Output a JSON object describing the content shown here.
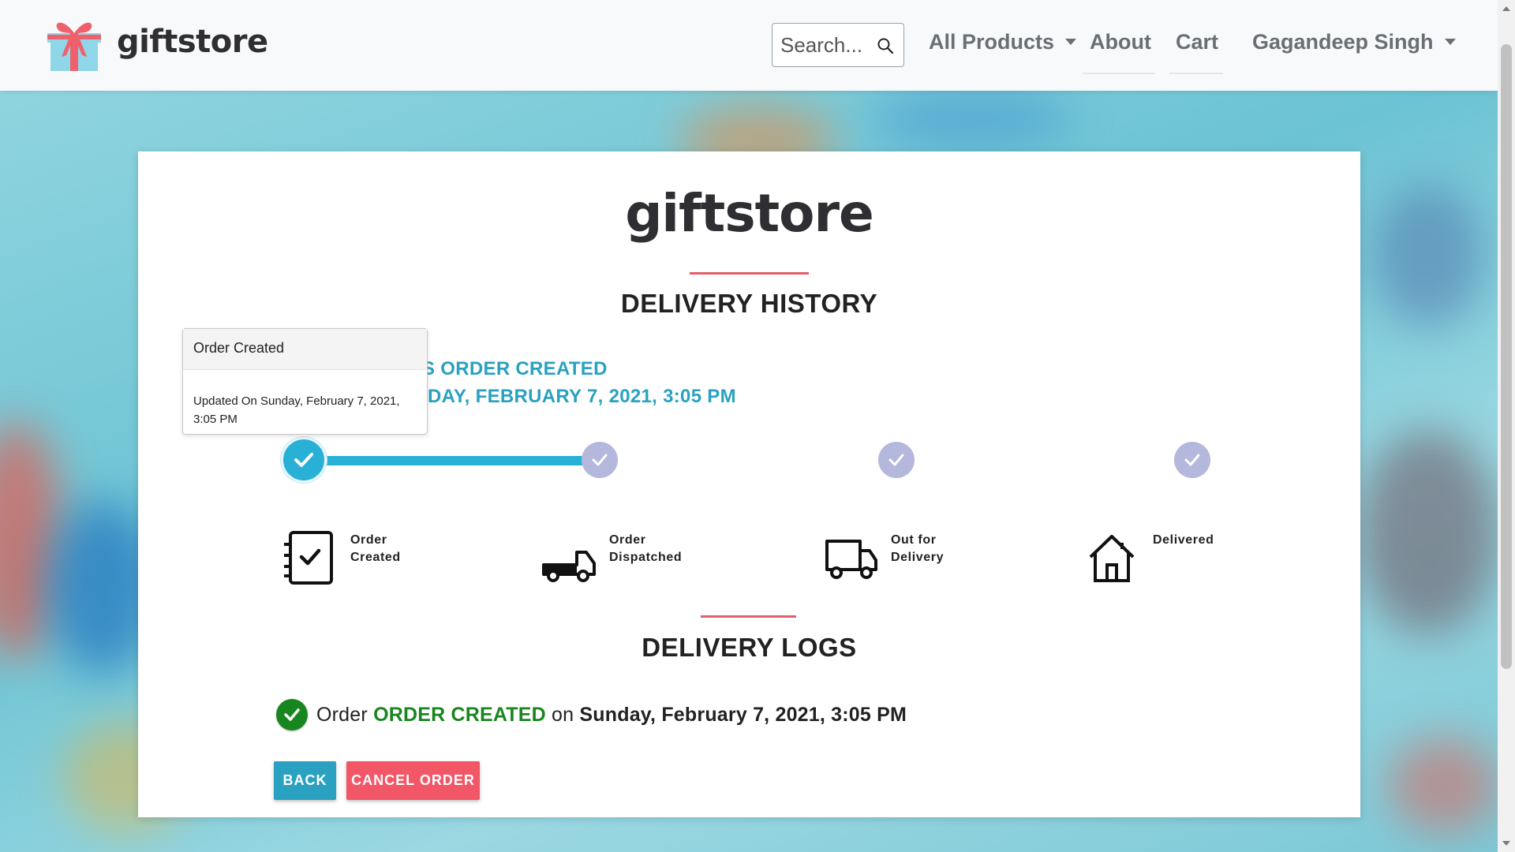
{
  "navbar": {
    "brand": "giftstore",
    "search_placeholder": "Search...",
    "all_products": "All Products",
    "about": "About",
    "cart": "Cart",
    "user": "Gagandeep Singh"
  },
  "card": {
    "brand": "giftstore",
    "history_title": "DELIVERY HISTORY",
    "status_line_1": "S ORDER CREATED",
    "status_line_2": "IDAY, FEBRUARY 7, 2021, 3:05 PM",
    "steps": [
      {
        "label_1": "Order",
        "label_2": "Created",
        "icon": "checklist-icon",
        "done": true
      },
      {
        "label_1": "Order",
        "label_2": "Dispatched",
        "icon": "flatbed-truck-icon",
        "done": false
      },
      {
        "label_1": "Out for",
        "label_2": "Delivery",
        "icon": "delivery-truck-icon",
        "done": false
      },
      {
        "label_1": "Delivered",
        "label_2": "",
        "icon": "house-icon",
        "done": false
      }
    ],
    "logs_title": "DELIVERY LOGS",
    "log": {
      "prefix": "Order",
      "status": "ORDER CREATED",
      "on": "on",
      "date": "Sunday, February 7, 2021, 3:05 PM"
    },
    "back_label": "BACK",
    "cancel_label": "CANCEL ORDER"
  },
  "popover": {
    "title": "Order Created",
    "body": "Updated On Sunday, February 7, 2021, 3:05 PM"
  },
  "colors": {
    "accent": "#29b0d6",
    "success": "#18861f",
    "danger": "#f25767",
    "idle_step": "#b3b8dc"
  }
}
